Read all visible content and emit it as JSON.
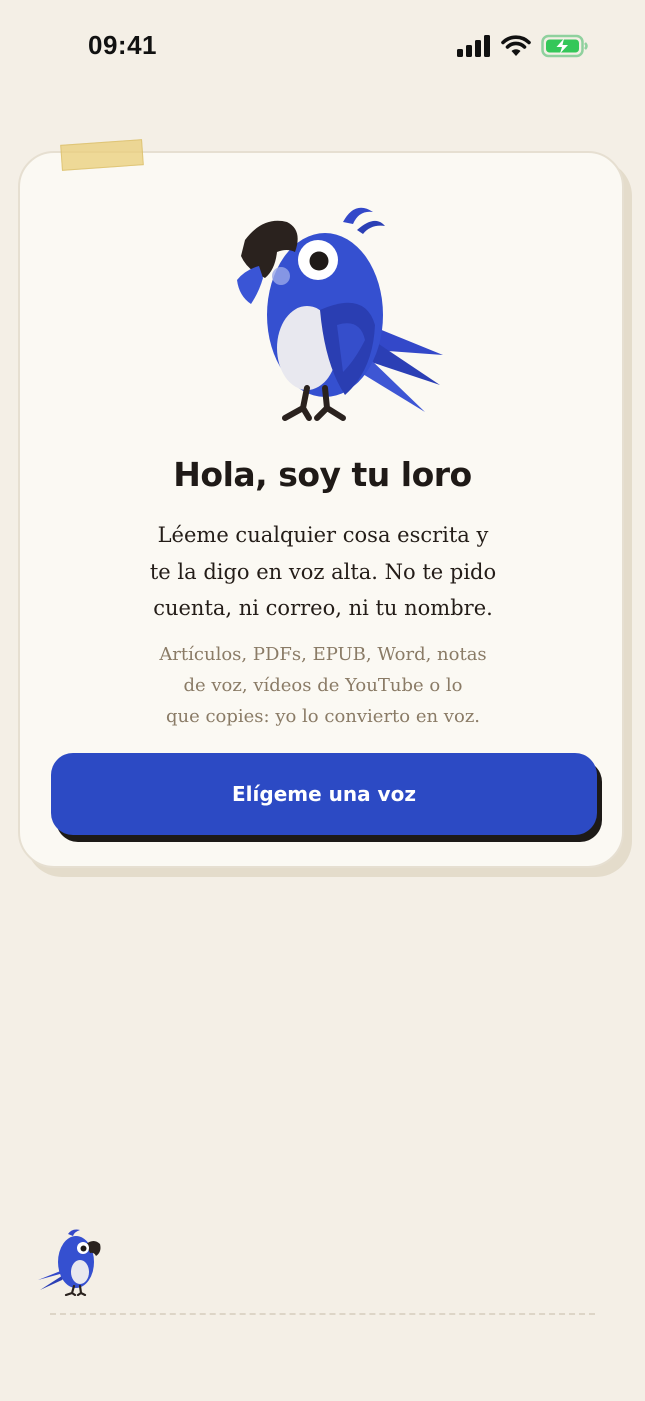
{
  "status_bar": {
    "time": "09:41",
    "icons": [
      "cellular-signal-icon",
      "wifi-icon",
      "battery-charging-icon"
    ]
  },
  "welcome": {
    "title": "Hola, soy tu loro",
    "lead_lines": [
      "Léeme cualquier cosa escrita y",
      "te la digo en voz alta. No te pido",
      "cuenta, ni correo, ni tu nombre."
    ],
    "sub_lines": [
      "Artículos, PDFs, EPUB, Word, notas",
      "de voz, vídeos de YouTube o lo",
      "que copies: yo lo convierto en voz."
    ],
    "cta_label": "Elígeme una voz"
  },
  "colors": {
    "background": "#f4efe6",
    "card": "#fbf9f3",
    "accent": "#2c4ac4",
    "text": "#1f1a17",
    "muted_text": "#8a7b66",
    "battery": "#34c759"
  }
}
